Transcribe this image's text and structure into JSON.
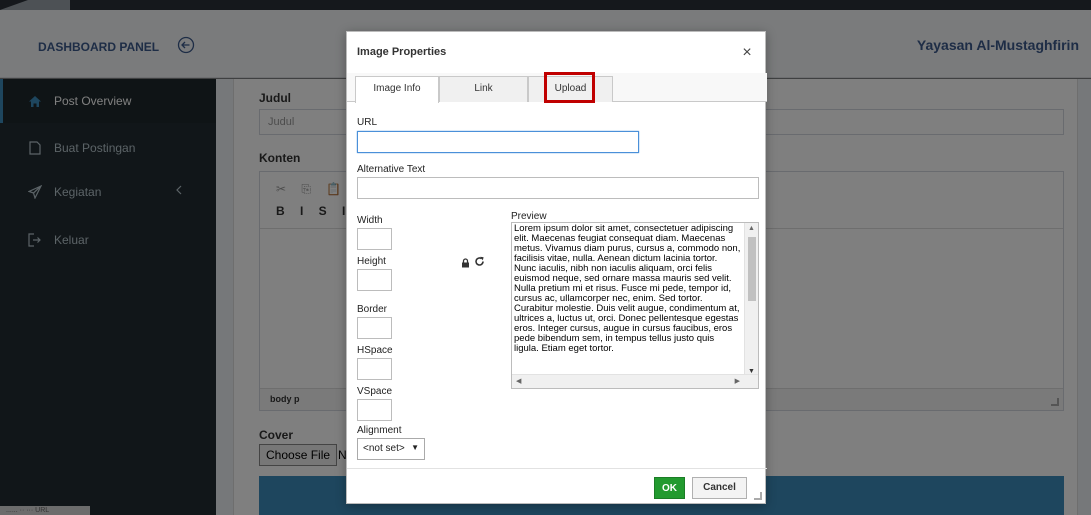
{
  "header": {
    "brand": "DASHBOARD PANEL",
    "site_name": "Yayasan Al-Mustaghfirin"
  },
  "sidebar": {
    "items": [
      {
        "label": "Post Overview",
        "icon": "home-icon"
      },
      {
        "label": "Buat Postingan",
        "icon": "file-icon"
      },
      {
        "label": "Kegiatan",
        "icon": "paper-plane-icon"
      },
      {
        "label": "Keluar",
        "icon": "sign-out-icon"
      }
    ]
  },
  "form": {
    "judul_label": "Judul",
    "judul_placeholder": "Judul",
    "konten_label": "Konten",
    "editor_toolbar_row1": "✂ ⎘ 📋 📋",
    "editor_toolbar_row2": "B I S I",
    "editor_path": "body  p",
    "cover_label": "Cover",
    "choose_file": "Choose File",
    "file_status": "N"
  },
  "statusbar": {
    "text": "...... ·· ··· URL"
  },
  "dialog": {
    "title": "Image Properties",
    "close": "×",
    "tabs": [
      {
        "label": "Image Info",
        "active": true
      },
      {
        "label": "Link",
        "active": false
      },
      {
        "label": "Upload",
        "active": false,
        "highlighted": true
      }
    ],
    "url_label": "URL",
    "url_value": "",
    "alt_label": "Alternative Text",
    "alt_value": "",
    "width_label": "Width",
    "height_label": "Height",
    "border_label": "Border",
    "hspace_label": "HSpace",
    "vspace_label": "VSpace",
    "alignment_label": "Alignment",
    "alignment_value": "<not set>",
    "preview_label": "Preview",
    "preview_text": "Lorem ipsum dolor sit amet, consectetuer adipiscing elit. Maecenas feugiat consequat diam. Maecenas metus. Vivamus diam purus, cursus a, commodo non, facilisis vitae, nulla. Aenean dictum lacinia tortor. Nunc iaculis, nibh non iaculis aliquam, orci felis euismod neque, sed ornare massa mauris sed velit. Nulla pretium mi et risus. Fusce mi pede, tempor id, cursus ac, ullamcorper nec, enim. Sed tortor. Curabitur molestie. Duis velit augue, condimentum at, ultrices a, luctus ut, orci. Donec pellentesque egestas eros. Integer cursus, augue in cursus faucibus, eros pede bibendum sem, in tempus tellus justo quis ligula. Etiam eget tortor.",
    "ok_label": "OK",
    "cancel_label": "Cancel"
  },
  "colors": {
    "brand": "#3c5a8c",
    "sidebar_bg": "#222d32",
    "ok_green": "#229a2f",
    "highlight_red": "#c00000",
    "submit_blue": "#3c8dbc"
  }
}
